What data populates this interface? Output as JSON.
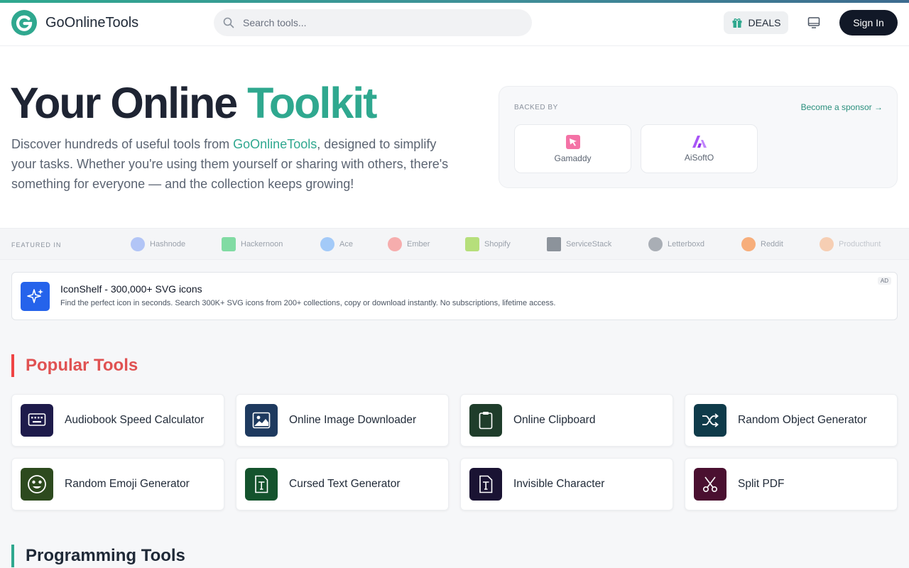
{
  "header": {
    "brand": "GoOnlineTools",
    "search_placeholder": "Search tools...",
    "deals_label": "DEALS",
    "signin_label": "Sign In"
  },
  "hero": {
    "title_main": "Your Online ",
    "title_accent": "Toolkit",
    "desc_before": "Discover hundreds of useful tools from ",
    "desc_link": "GoOnlineTools",
    "desc_after": ", designed to simplify your tasks. Whether you're using them yourself or sharing with others, there's something for everyone — and the collection keeps growing!"
  },
  "sponsors": {
    "label": "BACKED BY",
    "become": "Become a sponsor →",
    "items": [
      {
        "name": "Gamaddy",
        "color": "#f472a6"
      },
      {
        "name": "AiSoftO",
        "color": "#a855f7"
      }
    ]
  },
  "featured": {
    "label": "FEATURED IN",
    "items": [
      {
        "name": "Hashnode",
        "color": "#7c9cf5"
      },
      {
        "name": "Hackernoon",
        "color": "#22c55e"
      },
      {
        "name": "Ace",
        "color": "#60a5fa"
      },
      {
        "name": "Ember",
        "color": "#f87171"
      },
      {
        "name": "Shopify",
        "color": "#84cc16"
      },
      {
        "name": "ServiceStack",
        "color": "#374151"
      },
      {
        "name": "Letterboxd",
        "color": "#6b7280"
      },
      {
        "name": "Reddit",
        "color": "#f97316"
      },
      {
        "name": "Producthunt",
        "color": "#f97316"
      }
    ]
  },
  "ad": {
    "title": "IconShelf - 300,000+ SVG icons",
    "desc": "Find the perfect icon in seconds. Search 300K+ SVG icons from 200+ collections, copy or download instantly. No subscriptions, lifetime access.",
    "badge": "AD"
  },
  "popular": {
    "title": "Popular Tools",
    "tools": [
      {
        "label": "Audiobook Speed Calculator",
        "icon": "keyboard-icon",
        "color": "#1e1b4b"
      },
      {
        "label": "Online Image Downloader",
        "icon": "image-icon",
        "color": "#1e3a5f"
      },
      {
        "label": "Online Clipboard",
        "icon": "clipboard-icon",
        "color": "#1f3d2b"
      },
      {
        "label": "Random Object Generator",
        "icon": "shuffle-icon",
        "color": "#0f3b4a"
      },
      {
        "label": "Random Emoji Generator",
        "icon": "emoji-icon",
        "color": "#2d4a1e"
      },
      {
        "label": "Cursed Text Generator",
        "icon": "text-file-icon",
        "color": "#14532d"
      },
      {
        "label": "Invisible Character",
        "icon": "text-file-icon",
        "color": "#1a1333"
      },
      {
        "label": "Split PDF",
        "icon": "scissors-icon",
        "color": "#4a1030"
      }
    ]
  },
  "programming": {
    "title": "Programming Tools"
  }
}
